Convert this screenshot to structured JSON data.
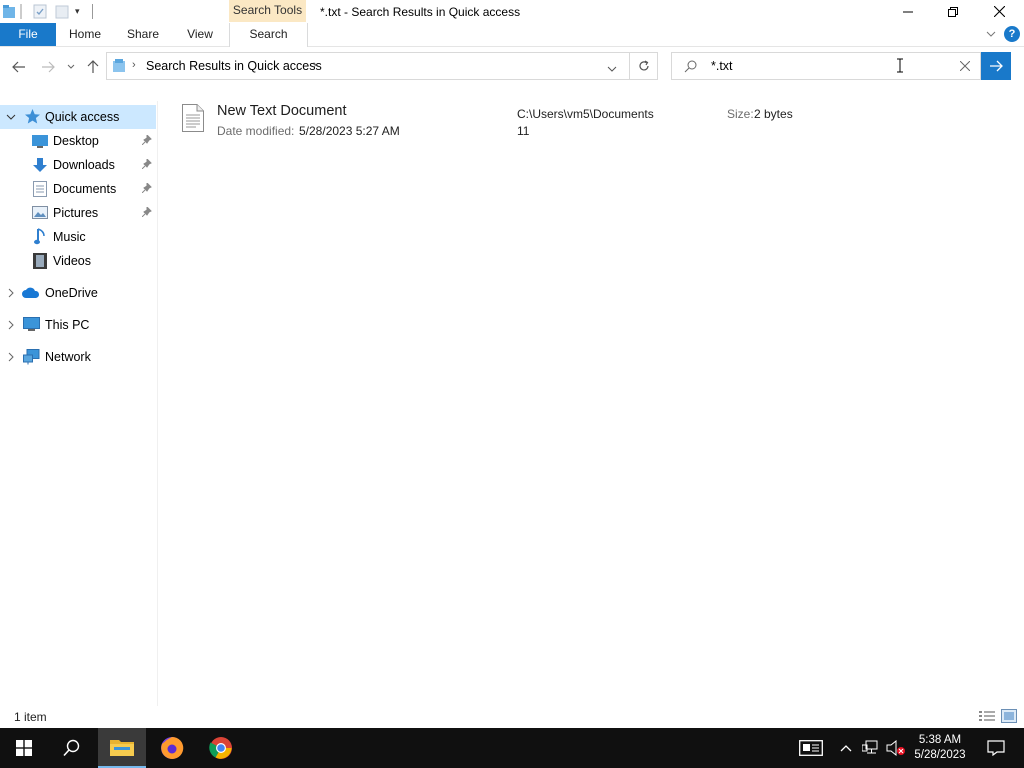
{
  "window": {
    "title": "*.txt - Search Results in Quick access",
    "contextual_tab_group": "Search Tools"
  },
  "ribbon": {
    "tabs": [
      "File",
      "Home",
      "Share",
      "View",
      "Search"
    ],
    "active_tab": "Search"
  },
  "navigation": {
    "address": "Search Results in Quick access",
    "search_value": "*.txt"
  },
  "nav_pane": {
    "quick_access_label": "Quick access",
    "pinned": [
      {
        "label": "Desktop",
        "icon": "desktop-icon",
        "pinned": true
      },
      {
        "label": "Downloads",
        "icon": "downloads-icon",
        "pinned": true
      },
      {
        "label": "Documents",
        "icon": "documents-icon",
        "pinned": true
      },
      {
        "label": "Pictures",
        "icon": "pictures-icon",
        "pinned": true
      },
      {
        "label": "Music",
        "icon": "music-icon",
        "pinned": false
      },
      {
        "label": "Videos",
        "icon": "videos-icon",
        "pinned": false
      }
    ],
    "roots": [
      {
        "label": "OneDrive",
        "icon": "onedrive-icon"
      },
      {
        "label": "This PC",
        "icon": "this-pc-icon"
      },
      {
        "label": "Network",
        "icon": "network-icon"
      }
    ]
  },
  "results": [
    {
      "name": "New Text Document",
      "date_label": "Date modified:",
      "date_value": "5/28/2023 5:27 AM",
      "path_line1": "C:\\Users\\vm5\\Documents",
      "path_line2": "11",
      "size_label": "Size:",
      "size_value": "2 bytes"
    }
  ],
  "status": {
    "item_count": "1 item"
  },
  "taskbar": {
    "time": "5:38 AM",
    "date": "5/28/2023"
  },
  "colors": {
    "accent": "#1979ca",
    "selected_nav": "#cce8ff",
    "contextual_tab": "#fbe8c4",
    "taskbar": "#101010"
  }
}
